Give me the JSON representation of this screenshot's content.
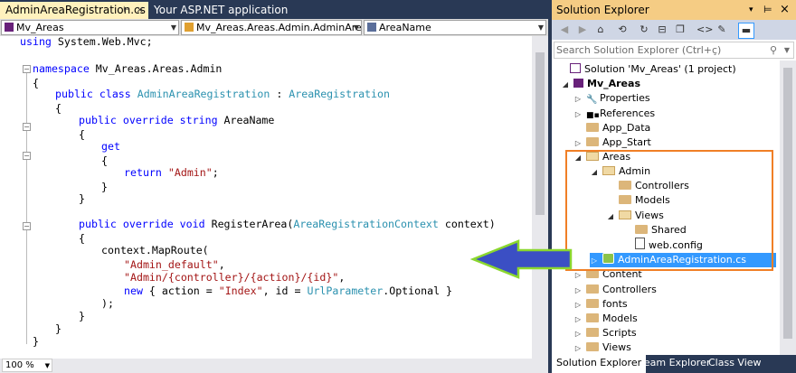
{
  "tabs": [
    {
      "label": "AdminAreaRegistration.cs",
      "pin": "⊨",
      "close": "×"
    },
    {
      "label": "Your ASP.NET application"
    }
  ],
  "nav": {
    "project": "Mv_Areas",
    "type": "Mv_Areas.Areas.Admin.AdminArea",
    "member": "AreaName"
  },
  "code": {
    "l1_kw": "using",
    "l1_rest": " System.Web.Mvc;",
    "l2_kw": "namespace",
    "l2_rest": " Mv_Areas.Areas.Admin",
    "l3": "{",
    "l4_kw": "public class ",
    "l4_type": "AdminAreaRegistration",
    "l4_colon": " : ",
    "l4_base": "AreaRegistration",
    "l5": "{",
    "l6_kw": "public override string",
    "l6_rest": " AreaName",
    "l7": "{",
    "l8_kw": "get",
    "l9": "{",
    "l10_kw": "return",
    "l10_space": " ",
    "l10_str": "\"Admin\"",
    "l10_end": ";",
    "l11": "}",
    "l12": "}",
    "l13_kw": "public override void",
    "l13_rest": " RegisterArea(",
    "l13_type": "AreaRegistrationContext",
    "l13_end": " context)",
    "l14": "{",
    "l15": "context.MapRoute(",
    "l16_str": "\"Admin_default\"",
    "l16_end": ",",
    "l17_str": "\"Admin/{controller}/{action}/{id}\"",
    "l17_end": ",",
    "l18_kw": "new",
    "l18_a": " { action = ",
    "l18_str": "\"Index\"",
    "l18_b": ", id = ",
    "l18_type": "UrlParameter",
    "l18_c": ".Optional }",
    "l19": ");",
    "l20": "}",
    "l21": "}",
    "l22": "}"
  },
  "zoom": "100 %",
  "solution_explorer": {
    "title": "Solution Explorer",
    "search_placeholder": "Search Solution Explorer (Ctrl+ç)",
    "tree": [
      "Solution 'Mv_Areas' (1 project)",
      "Mv_Areas",
      "Properties",
      "References",
      "App_Data",
      "App_Start",
      "Areas",
      "Admin",
      "Controllers",
      "Models",
      "Views",
      "Shared",
      "web.config",
      "AdminAreaRegistration.cs",
      "Content",
      "Controllers",
      "fonts",
      "Models",
      "Scripts",
      "Views"
    ],
    "bottom_tabs": [
      "Solution Explorer",
      "Team Explorer",
      "Class View"
    ]
  },
  "colors": {
    "frame": "#293955",
    "highlight": "#f07f26",
    "selection": "#3399ff",
    "arrow_fill": "#3b4fc4",
    "arrow_outline": "#8bd72e"
  }
}
